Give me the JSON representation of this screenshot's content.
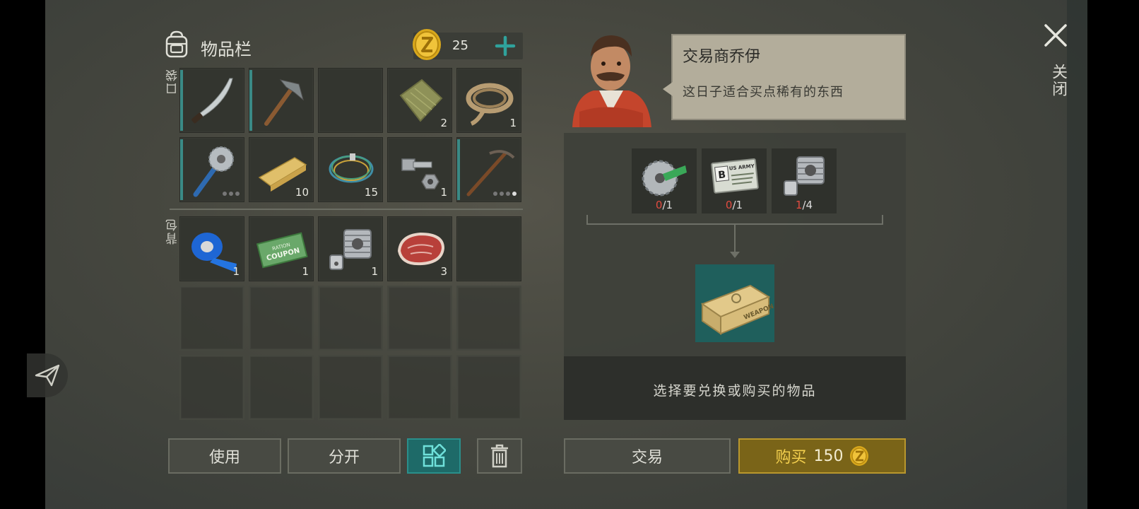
{
  "inventory": {
    "title": "物品栏",
    "coins": "25",
    "pocket_label": "口袋",
    "backpack_label": "背包",
    "pocket_slots": [
      {
        "item": "machete-icon",
        "count": "",
        "durability_bar": true
      },
      {
        "item": "pickaxe-icon",
        "count": "",
        "durability_bar": true
      },
      {
        "item": "",
        "count": "",
        "durability_bar": false
      },
      {
        "item": "cloth-icon",
        "count": "2",
        "durability_bar": false
      },
      {
        "item": "rope-icon",
        "count": "1",
        "durability_bar": false
      },
      {
        "item": "saw-mace-icon",
        "count": "",
        "durability_bar": true
      },
      {
        "item": "plank-icon",
        "count": "10",
        "durability_bar": false
      },
      {
        "item": "wire-icon",
        "count": "15",
        "durability_bar": false
      },
      {
        "item": "bolt-nut-icon",
        "count": "1",
        "durability_bar": false
      },
      {
        "item": "pick-icon",
        "count": "",
        "durability_bar": true
      }
    ],
    "backpack_slots": [
      {
        "item": "tape-icon",
        "count": "1"
      },
      {
        "item": "ration-coupon-icon",
        "count": "1"
      },
      {
        "item": "engine-cylinder-icon",
        "count": "1"
      },
      {
        "item": "steak-icon",
        "count": "3"
      }
    ],
    "coupon_text_1": "RATION",
    "coupon_text_2": "COUPON",
    "buttons": {
      "use": "使用",
      "split": "分开"
    }
  },
  "trader": {
    "name": "交易商乔伊",
    "message": "这日子适合买点稀有的东西",
    "requirements": [
      {
        "item": "saw-blade-icon",
        "have": "0",
        "need": "/1"
      },
      {
        "item": "army-card-icon",
        "have": "0",
        "need": "/1"
      },
      {
        "item": "engine-cylinder-icon",
        "have": "1",
        "need": "/4"
      }
    ],
    "army_card_text": "US ARMY",
    "result_item": "weapon-crate-icon",
    "crate_text": "WEAPON",
    "footer": "选择要兑换或购买的物品",
    "trade_button": "交易",
    "buy_button": "购买",
    "buy_price": "150"
  },
  "close_label": "关闭",
  "colors": {
    "accent_teal": "#2a8f8b",
    "gold": "#f3cf4e",
    "missing_red": "#e14b40"
  }
}
